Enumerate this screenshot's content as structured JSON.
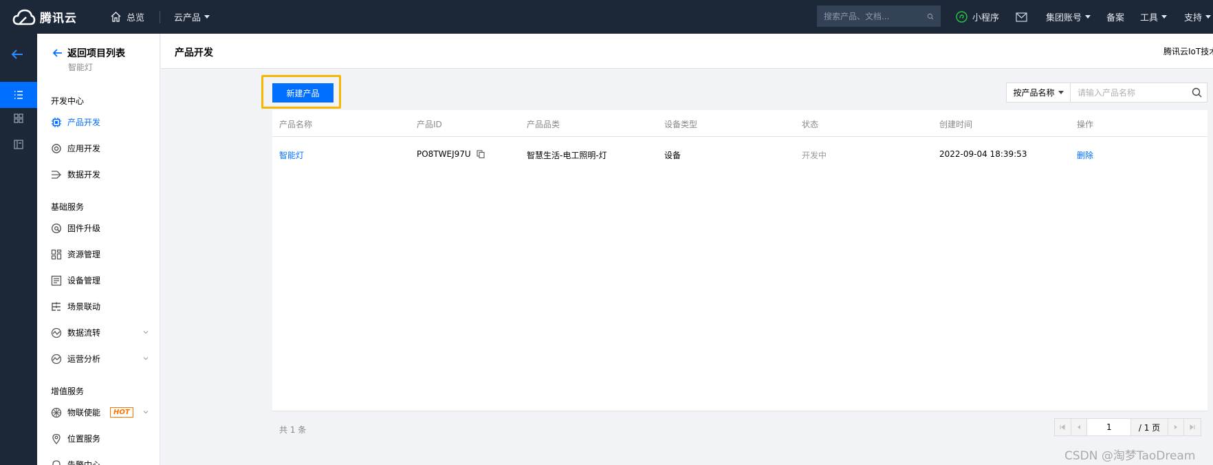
{
  "topbar": {
    "logo_text": "腾讯云",
    "home_label": "总览",
    "products_label": "云产品",
    "search_placeholder": "搜索产品、文档...",
    "mini_program": "小程序",
    "group_account": "集团账号",
    "beian": "备案",
    "tools": "工具",
    "support": "支持"
  },
  "side": {
    "back_label": "返回项目列表",
    "project_name": "智能灯",
    "sections": [
      {
        "title": "开发中心",
        "items": [
          {
            "label": "产品开发",
            "icon": "chip-icon",
            "active": true
          },
          {
            "label": "应用开发",
            "icon": "gear-icon"
          },
          {
            "label": "数据开发",
            "icon": "flow-icon"
          }
        ]
      },
      {
        "title": "基础服务",
        "items": [
          {
            "label": "固件升级",
            "icon": "upgrade-icon"
          },
          {
            "label": "资源管理",
            "icon": "resource-icon"
          },
          {
            "label": "设备管理",
            "icon": "device-icon"
          },
          {
            "label": "场景联动",
            "icon": "scene-icon"
          },
          {
            "label": "数据流转",
            "icon": "data-flow-icon",
            "expandable": true
          },
          {
            "label": "运营分析",
            "icon": "analysis-icon",
            "expandable": true
          }
        ]
      },
      {
        "title": "增值服务",
        "items": [
          {
            "label": "物联使能",
            "icon": "iot-icon",
            "badge": "HOT",
            "expandable": true
          },
          {
            "label": "位置服务",
            "icon": "location-icon"
          },
          {
            "label": "告警中心",
            "icon": "alarm-icon"
          }
        ]
      }
    ]
  },
  "header": {
    "title": "产品开发",
    "right_text": "腾讯云IoT技术"
  },
  "toolbar": {
    "new_product": "新建产品",
    "filter_select": "按产品名称",
    "filter_placeholder": "请输入产品名称"
  },
  "table": {
    "columns": [
      "产品名称",
      "产品ID",
      "产品品类",
      "设备类型",
      "状态",
      "创建时间",
      "操作"
    ],
    "rows": [
      {
        "name": "智能灯",
        "id": "PO8TWEJ97U",
        "category": "智慧生活-电工照明-灯",
        "device_type": "设备",
        "status": "开发中",
        "created": "2022-09-04 18:39:53",
        "action": "删除"
      }
    ]
  },
  "pagination": {
    "total_text": "共 1 条",
    "current_page": "1",
    "total_pages": "/ 1 页"
  },
  "watermark": "CSDN @淘梦TaoDream",
  "colors": {
    "topbar_bg": "#1c2738",
    "accent": "#006eff",
    "highlight_border": "#f7b500",
    "hot": "#ff7200"
  }
}
